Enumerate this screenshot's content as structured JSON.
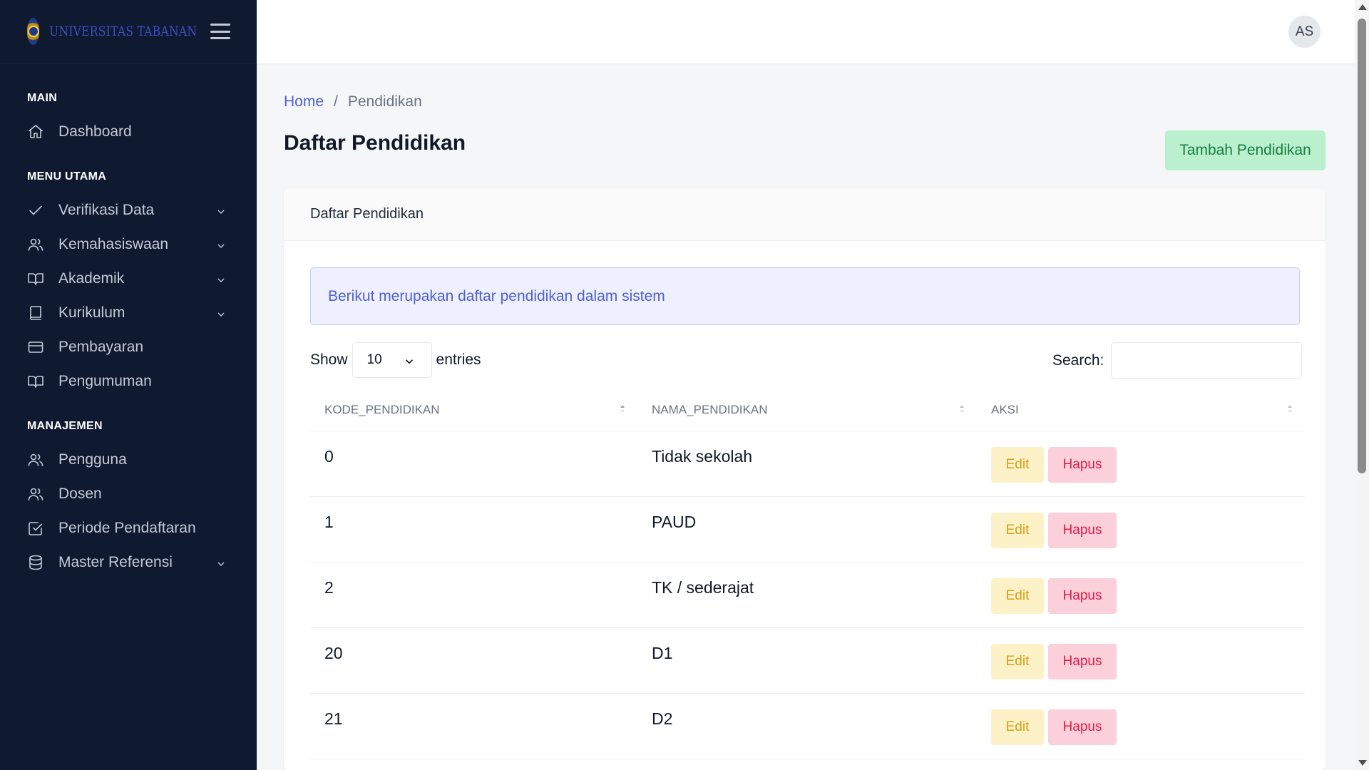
{
  "brand": {
    "name": "UNIVERSITAS TABANAN"
  },
  "sidebar": {
    "sections": [
      {
        "title": "MAIN",
        "items": [
          {
            "label": "Dashboard",
            "icon": "home-icon",
            "has_chevron": false
          }
        ]
      },
      {
        "title": "MENU UTAMA",
        "items": [
          {
            "label": "Verifikasi Data",
            "icon": "check-icon",
            "has_chevron": true
          },
          {
            "label": "Kemahasiswaan",
            "icon": "users-icon",
            "has_chevron": true
          },
          {
            "label": "Akademik",
            "icon": "book-open-icon",
            "has_chevron": true
          },
          {
            "label": "Kurikulum",
            "icon": "book-icon",
            "has_chevron": true
          },
          {
            "label": "Pembayaran",
            "icon": "credit-card-icon",
            "has_chevron": false
          },
          {
            "label": "Pengumuman",
            "icon": "book-open-icon",
            "has_chevron": false
          }
        ]
      },
      {
        "title": "MANAJEMEN",
        "items": [
          {
            "label": "Pengguna",
            "icon": "users-icon",
            "has_chevron": false
          },
          {
            "label": "Dosen",
            "icon": "users-icon",
            "has_chevron": false
          },
          {
            "label": "Periode Pendaftaran",
            "icon": "check-square-icon",
            "has_chevron": false
          },
          {
            "label": "Master Referensi",
            "icon": "database-icon",
            "has_chevron": true
          }
        ]
      }
    ]
  },
  "topbar": {
    "avatar_initials": "AS"
  },
  "breadcrumb": {
    "home": "Home",
    "separator": "/",
    "current": "Pendidikan"
  },
  "page": {
    "title": "Daftar Pendidikan",
    "add_button": "Tambah Pendidikan"
  },
  "card": {
    "header": "Daftar Pendidikan",
    "alert": "Berikut merupakan daftar pendidikan dalam sistem",
    "length": {
      "show_label": "Show",
      "value": "10",
      "entries_label": "entries"
    },
    "search": {
      "label": "Search:",
      "value": ""
    }
  },
  "table": {
    "columns": [
      "KODE_PENDIDIKAN",
      "NAMA_PENDIDIKAN",
      "AKSI"
    ],
    "rows": [
      {
        "kode": "0",
        "nama": "Tidak sekolah"
      },
      {
        "kode": "1",
        "nama": "PAUD"
      },
      {
        "kode": "2",
        "nama": "TK / sederajat"
      },
      {
        "kode": "20",
        "nama": "D1"
      },
      {
        "kode": "21",
        "nama": "D2"
      }
    ],
    "edit_label": "Edit",
    "delete_label": "Hapus"
  },
  "colors": {
    "sidebar_bg": "#0f1a30",
    "accent": "#4f5fd1",
    "success_bg": "#bbf0cf",
    "warning_bg": "#fdf1c7",
    "danger_bg": "#fbd0da"
  }
}
